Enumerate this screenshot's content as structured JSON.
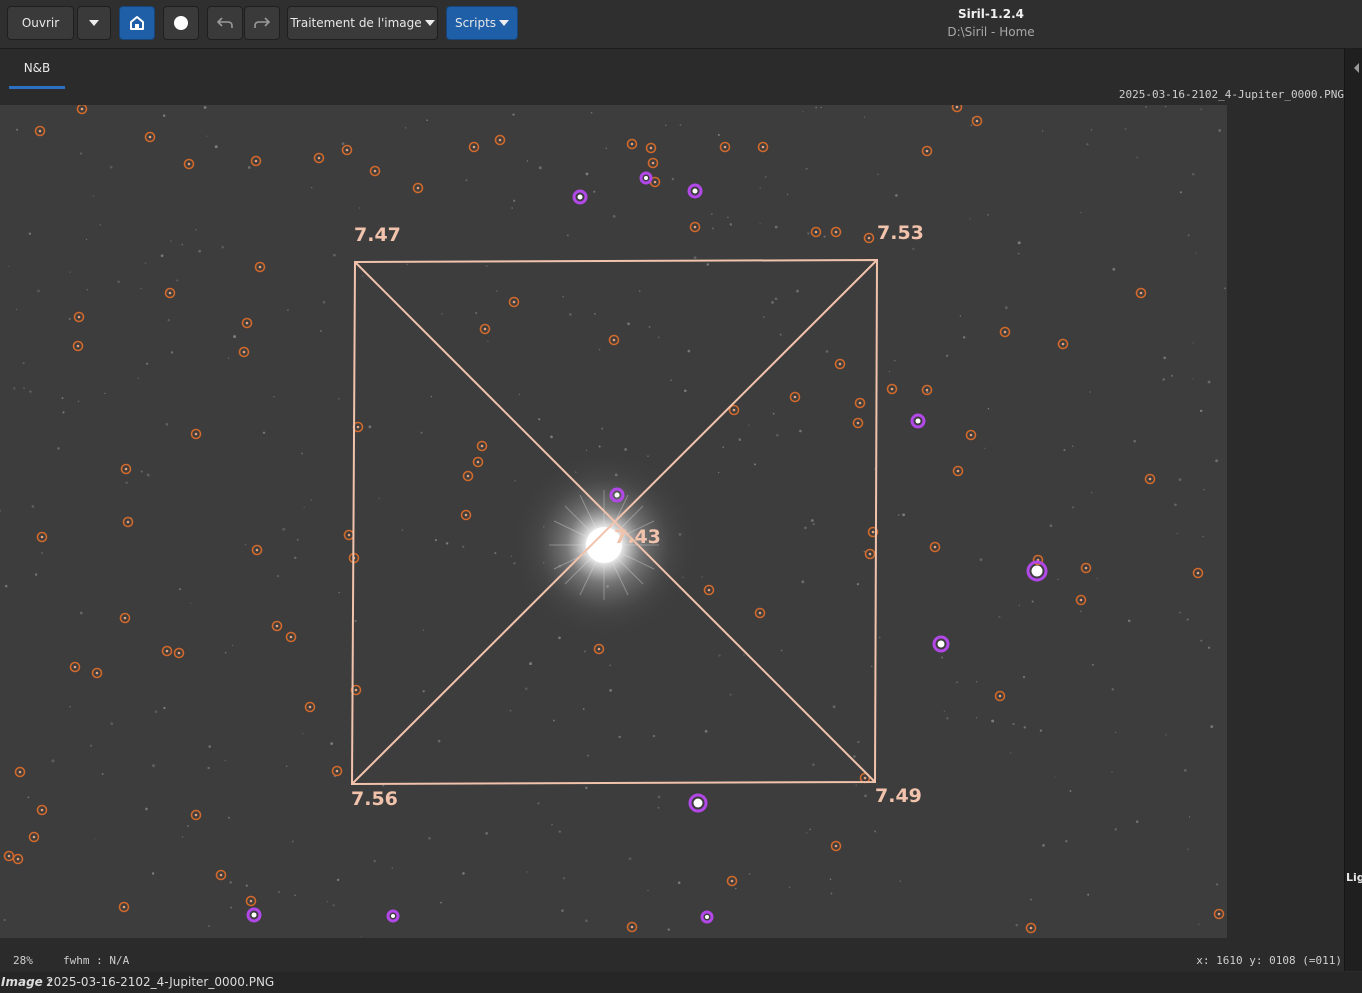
{
  "toolbar": {
    "open_label": "Ouvrir",
    "processing_label": "Traitement de l'image",
    "scripts_label": "Scripts",
    "icons": {
      "dropdown": "chevron-down-icon",
      "home": "home-icon",
      "record": "circle-icon",
      "undo": "undo-icon",
      "redo": "redo-icon"
    }
  },
  "window": {
    "title": "Siril-1.2.4",
    "subtitle": "D:\\Siril - Home"
  },
  "tabs": [
    {
      "label": "N&B",
      "active": true
    }
  ],
  "image": {
    "filename": "2025-03-16-2102_4-Jupiter_0000.PNG"
  },
  "tilt": {
    "corner_top_left": "7.47",
    "corner_top_right": "7.53",
    "corner_bottom_left": "7.56",
    "corner_bottom_right": "7.49",
    "center": "7.43",
    "line_color": "#f2c3ac"
  },
  "status": {
    "zoom": "28%",
    "fwhm": "fwhm : N/A",
    "coords": "x: 1610 y: 0108 (=011)"
  },
  "footer": {
    "image_label": "Image :",
    "image_value": "2025-03-16-2102_4-Jupiter_0000.PNG"
  },
  "side_panel": {
    "label": "Lig"
  },
  "colors": {
    "star_marker": "#d0692b",
    "saturated_marker": "#b248e8",
    "accent": "#1f5fa8"
  }
}
